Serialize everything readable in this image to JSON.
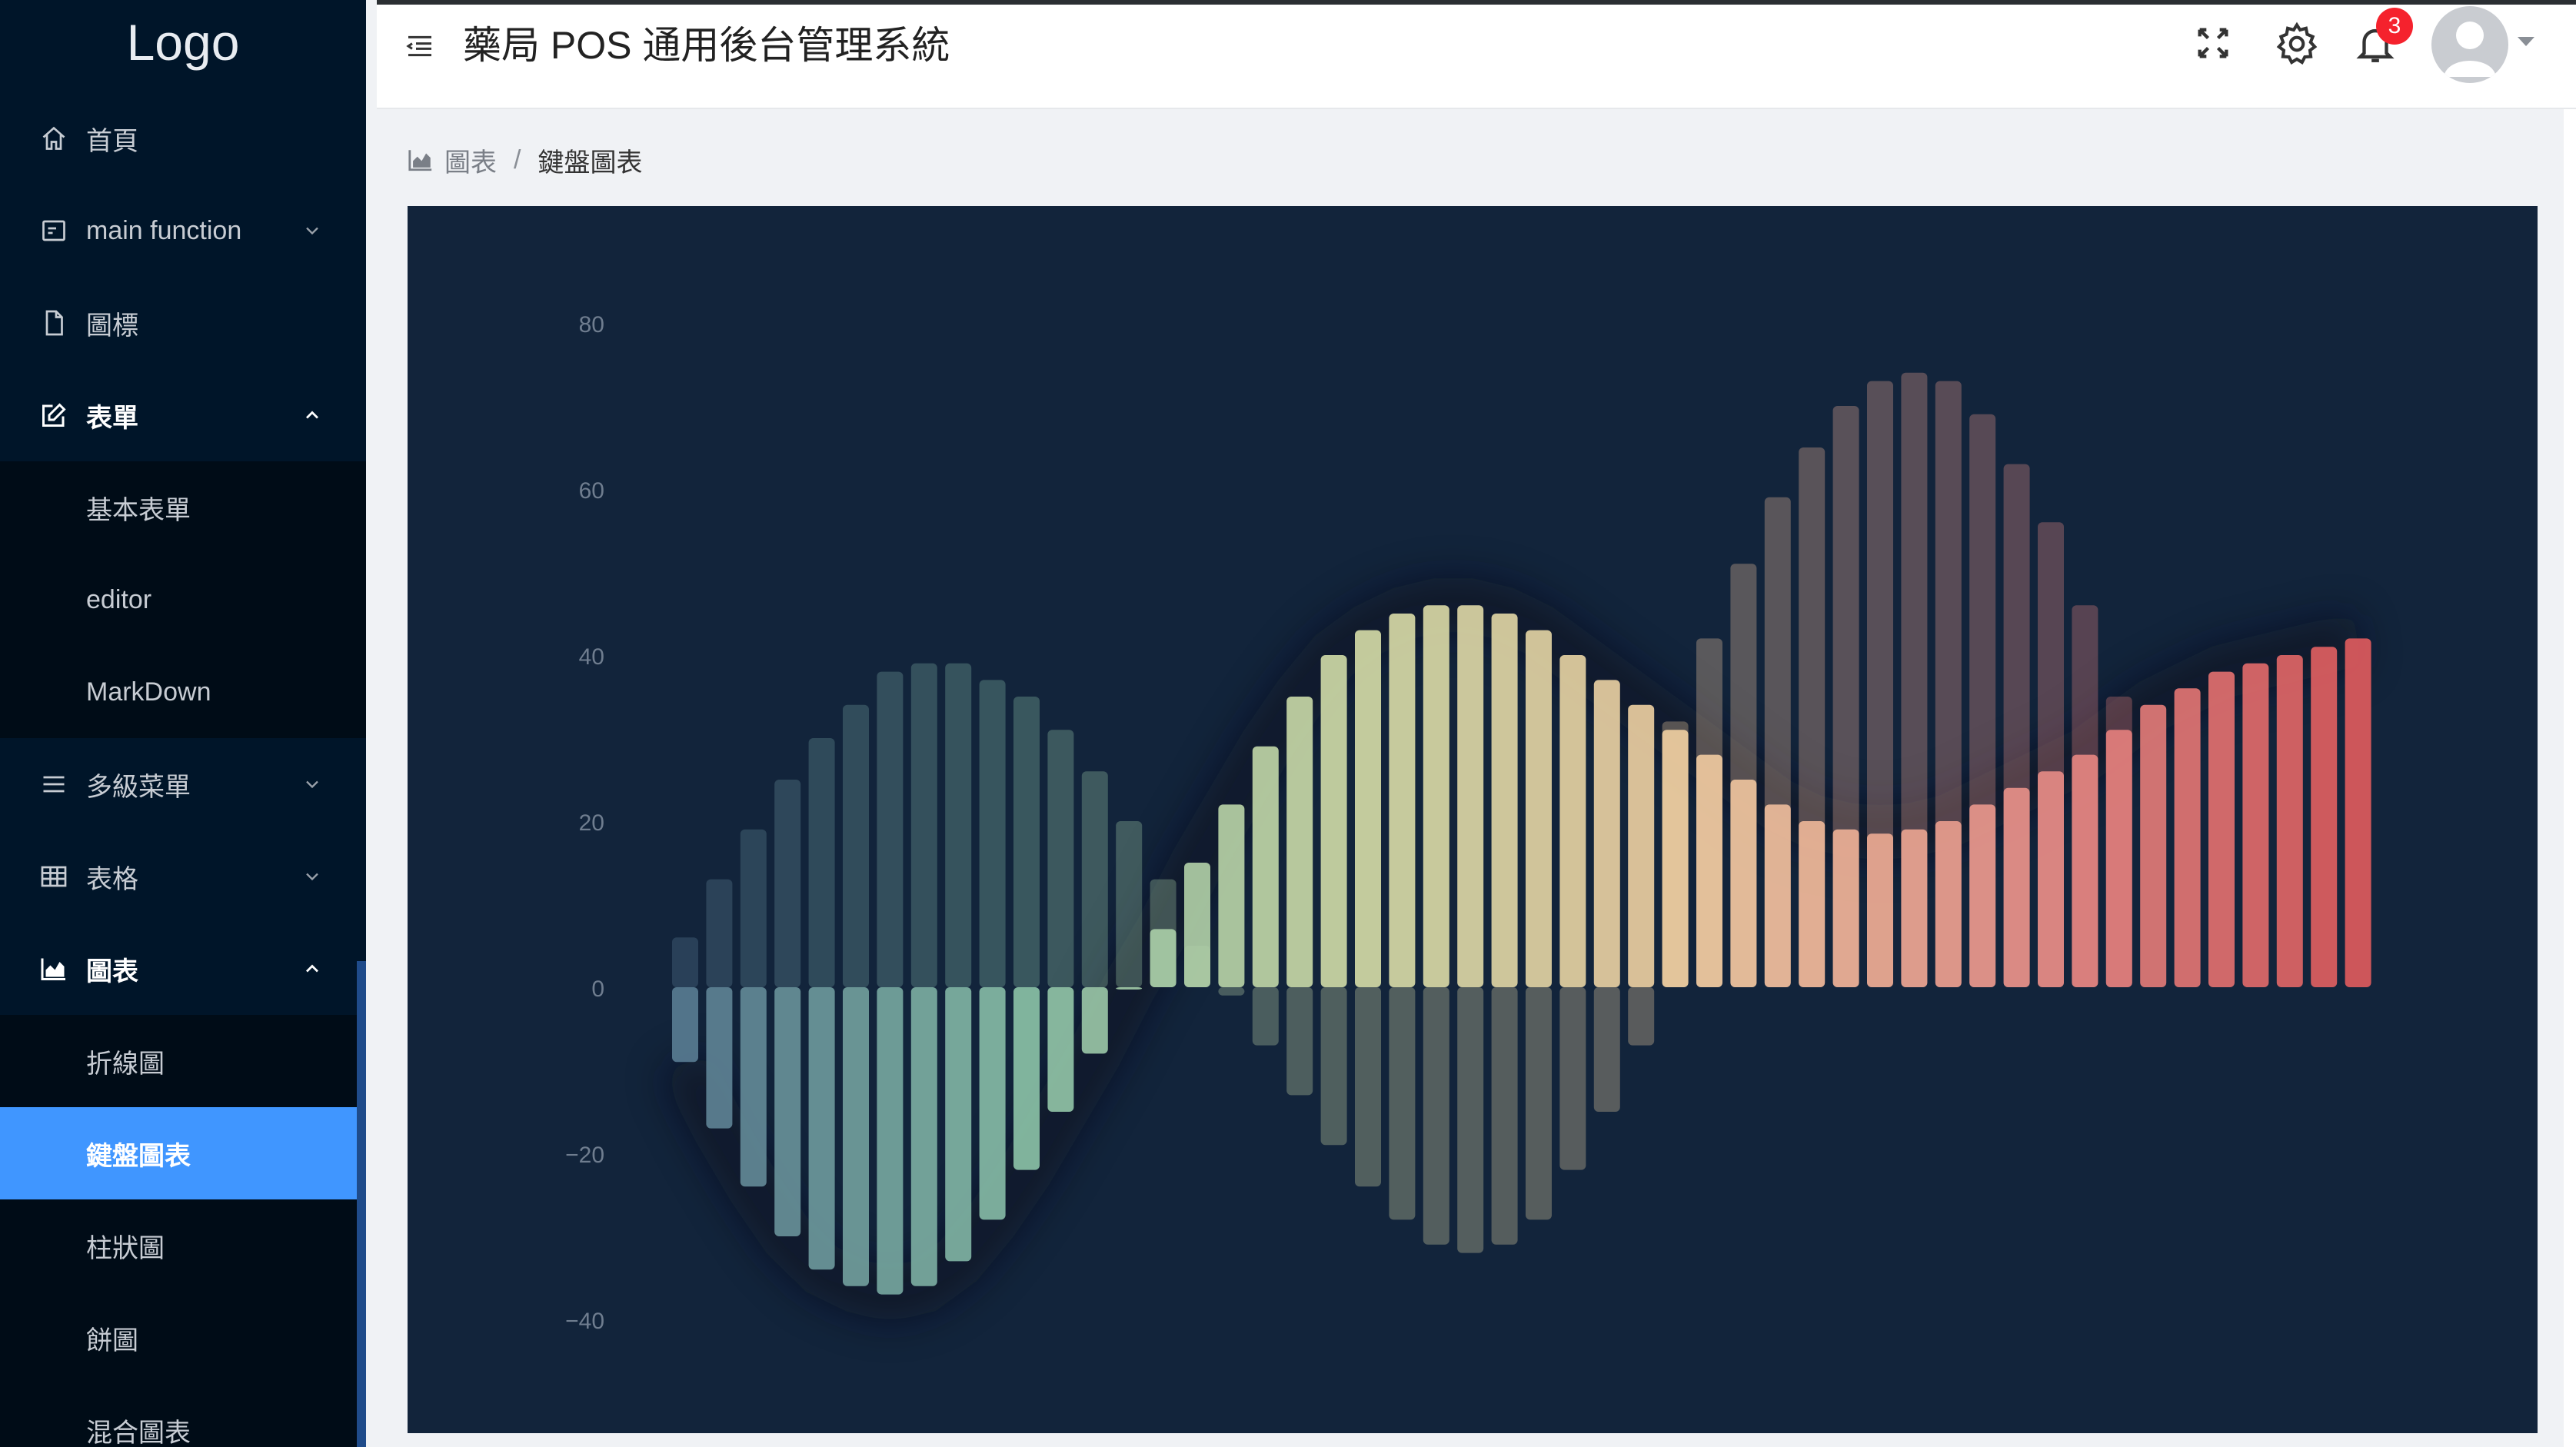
{
  "sidebar": {
    "logo": "Logo",
    "items": [
      {
        "label": "首頁",
        "icon": "home-icon"
      },
      {
        "label": "main function",
        "icon": "function-icon"
      },
      {
        "label": "圖標",
        "icon": "file-icon"
      },
      {
        "label": "表單",
        "icon": "edit-icon"
      },
      {
        "label": "多級菜單",
        "icon": "list-icon"
      },
      {
        "label": "表格",
        "icon": "table-icon"
      },
      {
        "label": "圖表",
        "icon": "area-chart-icon"
      }
    ],
    "form_children": [
      "基本表單",
      "editor",
      "MarkDown"
    ],
    "chart_children": [
      "折線圖",
      "鍵盤圖表",
      "柱狀圖",
      "餅圖",
      "混合圖表"
    ]
  },
  "header": {
    "title": "藥局 POS 通用後台管理系統",
    "notification_count": "3"
  },
  "breadcrumb": {
    "parent": "圖表",
    "separator": "/",
    "current": "鍵盤圖表"
  },
  "chart_data": {
    "type": "bar",
    "ylim": [
      -40,
      80
    ],
    "yticks": [
      80,
      60,
      40,
      20,
      0,
      -20,
      -40
    ],
    "tick_labels": [
      "80",
      "60",
      "40",
      "20",
      "0",
      "−20",
      "−40"
    ],
    "grid": false,
    "legend": "none",
    "n": 50,
    "bar_series": {
      "name": "",
      "values": [
        -9,
        -17,
        -24,
        -30,
        -34,
        -36,
        -37,
        -36,
        -33,
        -28,
        -22,
        -15,
        -8,
        0,
        7,
        15,
        22,
        29,
        35,
        40,
        43,
        45,
        46,
        46,
        45,
        43,
        40,
        37,
        34,
        31,
        28,
        25,
        22,
        20,
        19,
        18.5,
        19,
        20,
        22,
        24,
        26,
        28,
        31,
        34,
        36,
        38,
        39,
        40,
        41,
        42
      ],
      "colors_from": "#5a7d94",
      "colors_via": [
        "#8bc3a9",
        "#d6dfa9",
        "#f3cfa2",
        "#e9908a"
      ],
      "colors_to": "#e25c5e"
    },
    "shadow_series": {
      "name": "",
      "values": [
        6,
        13,
        19,
        25,
        30,
        34,
        38,
        39,
        39,
        37,
        35,
        31,
        26,
        20,
        13,
        5,
        -1,
        -7,
        -13,
        -19,
        -24,
        -28,
        -31,
        -32,
        -31,
        -28,
        -22,
        -15,
        -7,
        32,
        42,
        51,
        59,
        65,
        70,
        73,
        74,
        73,
        69,
        63,
        56,
        46,
        35
      ]
    }
  }
}
